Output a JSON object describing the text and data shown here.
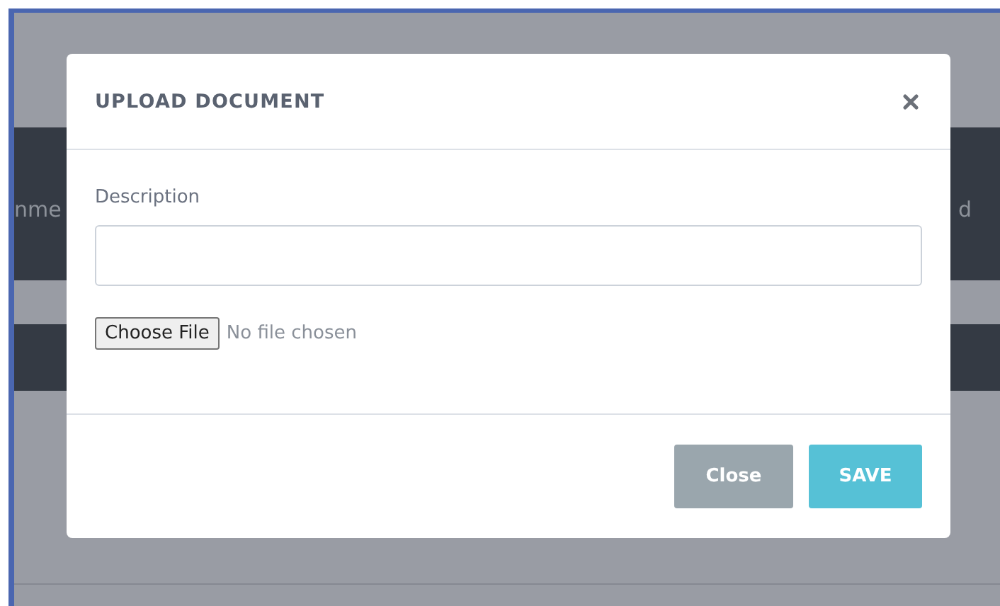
{
  "background": {
    "header_texts": [
      "nme",
      "d"
    ]
  },
  "modal": {
    "title": "UPLOAD DOCUMENT",
    "fields": [
      {
        "label": "Description",
        "kind": "text"
      }
    ],
    "file": {
      "button": "Choose File",
      "status": "No file chosen"
    },
    "buttons": [
      {
        "label": "Close",
        "kind": "secondary"
      },
      {
        "label": "SAVE",
        "kind": "primary"
      }
    ]
  }
}
